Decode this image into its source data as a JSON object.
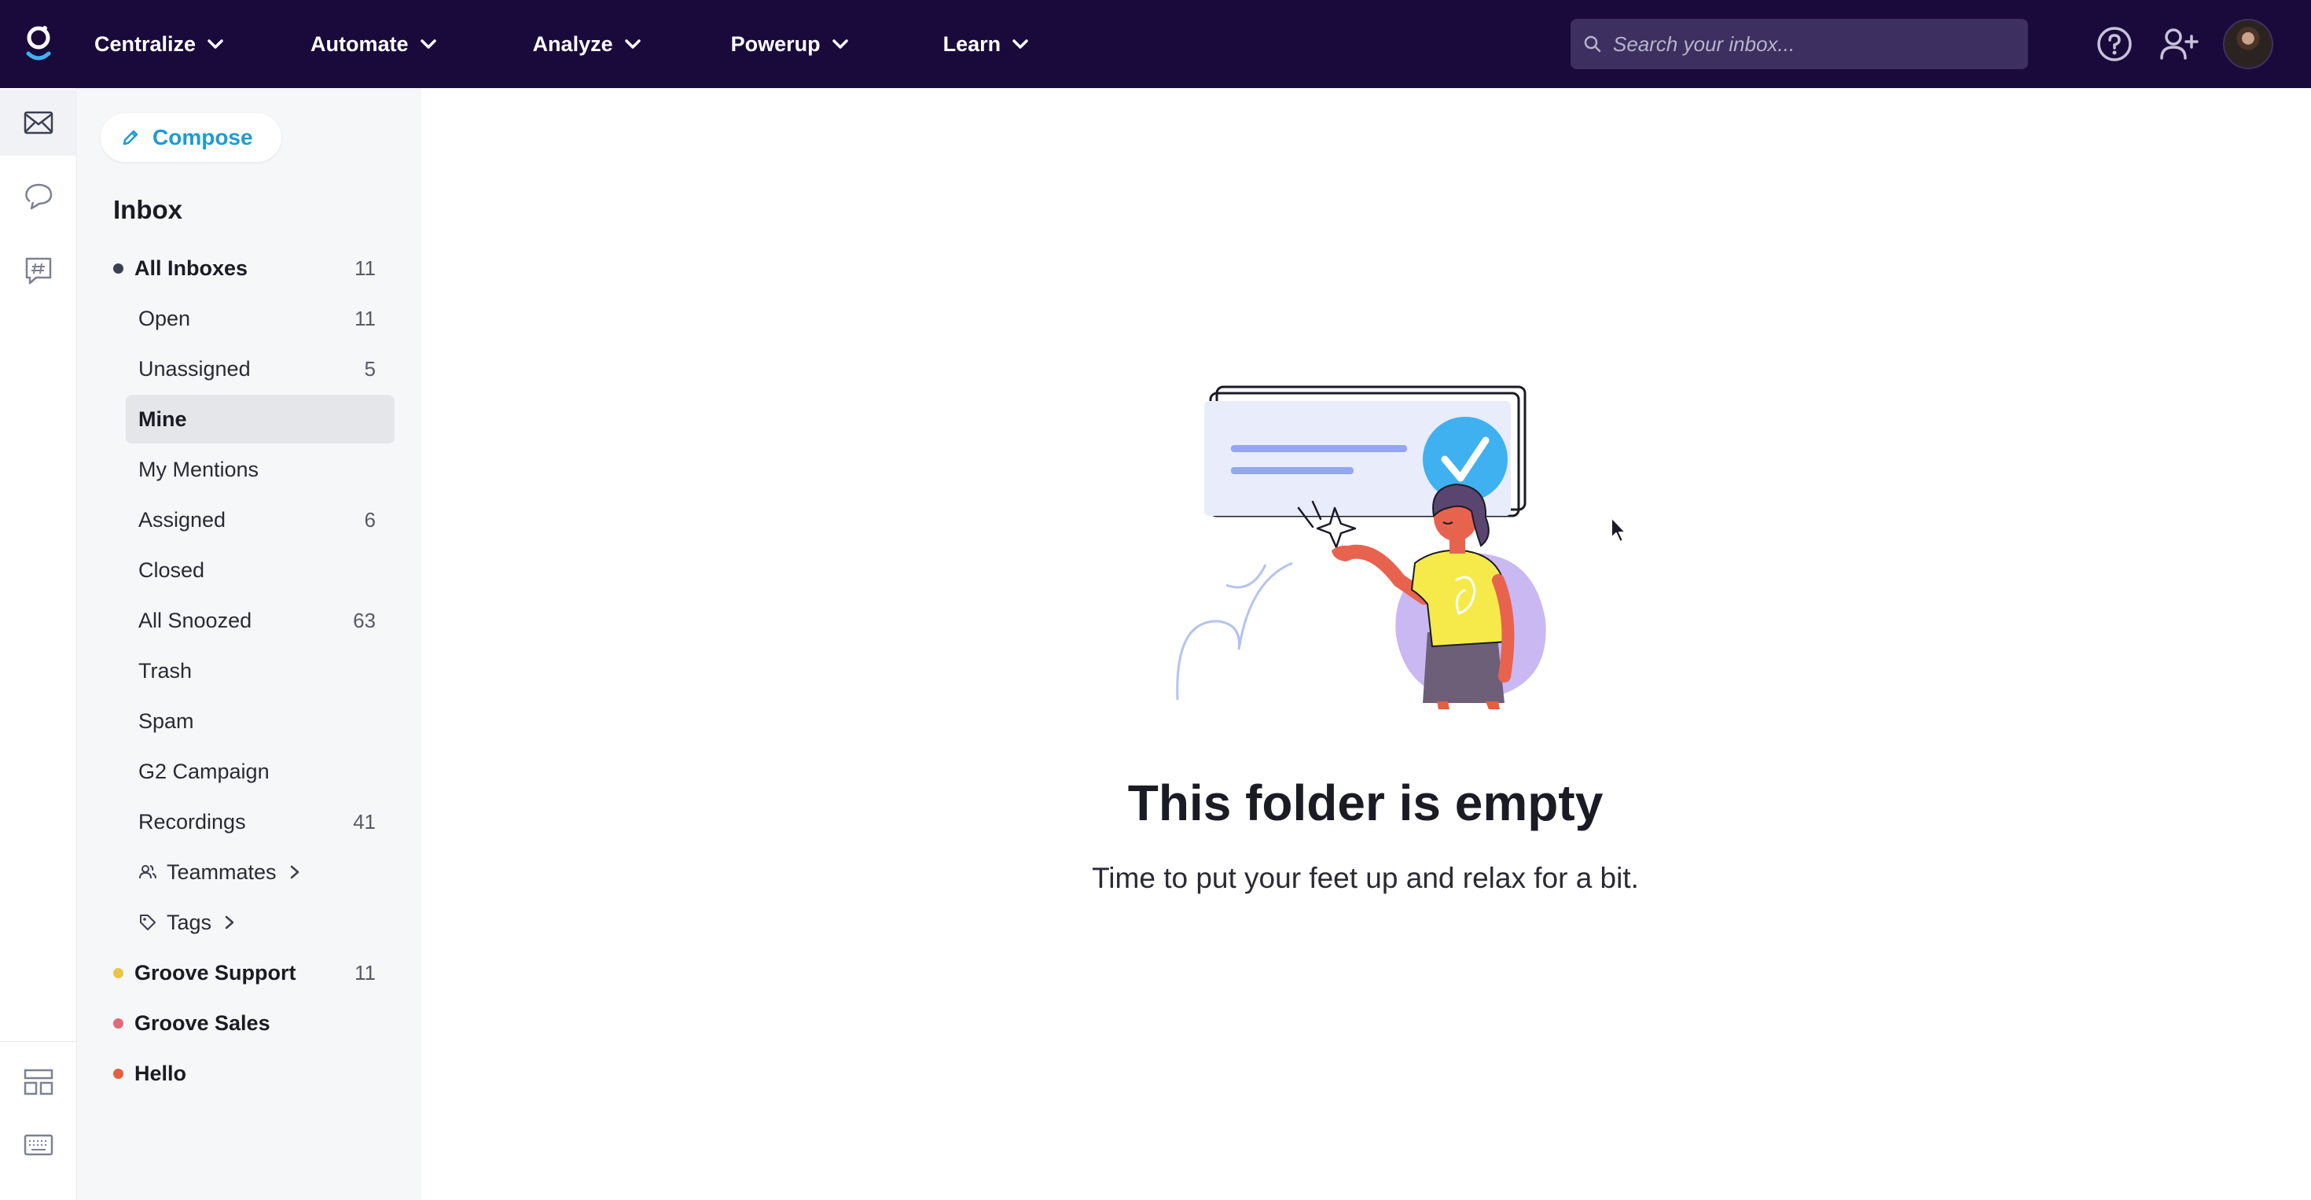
{
  "topbar": {
    "nav": [
      {
        "label": "Centralize"
      },
      {
        "label": "Automate"
      },
      {
        "label": "Analyze"
      },
      {
        "label": "Powerup"
      },
      {
        "label": "Learn"
      }
    ],
    "search_placeholder": "Search your inbox...",
    "icons": [
      "help-icon",
      "add-user-icon",
      "avatar"
    ]
  },
  "rail": {
    "icons": [
      "mail-icon",
      "chat-icon",
      "hashtag-chat-icon",
      "layout-icon",
      "keyboard-icon"
    ]
  },
  "sidebar": {
    "compose_label": "Compose",
    "inbox_title": "Inbox",
    "all_inboxes": {
      "label": "All Inboxes",
      "count": "11",
      "color": "#3b3f52"
    },
    "folders": [
      {
        "label": "Open",
        "count": "11"
      },
      {
        "label": "Unassigned",
        "count": "5"
      },
      {
        "label": "Mine",
        "count": "",
        "selected": true
      },
      {
        "label": "My Mentions",
        "count": ""
      },
      {
        "label": "Assigned",
        "count": "6"
      },
      {
        "label": "Closed",
        "count": ""
      },
      {
        "label": "All Snoozed",
        "count": "63"
      },
      {
        "label": "Trash",
        "count": ""
      },
      {
        "label": "Spam",
        "count": ""
      },
      {
        "label": "G2 Campaign",
        "count": ""
      },
      {
        "label": "Recordings",
        "count": "41"
      }
    ],
    "teammates_label": "Teammates",
    "tags_label": "Tags",
    "groups": [
      {
        "label": "Groove Support",
        "count": "11",
        "color": "#e8c547"
      },
      {
        "label": "Groove Sales",
        "count": "",
        "color": "#e06a7a"
      },
      {
        "label": "Hello",
        "count": "",
        "color": "#e2603f"
      }
    ]
  },
  "main": {
    "empty_title": "This folder is empty",
    "empty_subtitle": "Time to put your feet up and relax for a bit."
  },
  "colors": {
    "topbar_bg": "#1a0a3c",
    "accent": "#1f9ad6",
    "check_blue": "#3fb1f0",
    "shirt_yellow": "#f5ea4a",
    "blob_purple": "#c9b8f2"
  }
}
